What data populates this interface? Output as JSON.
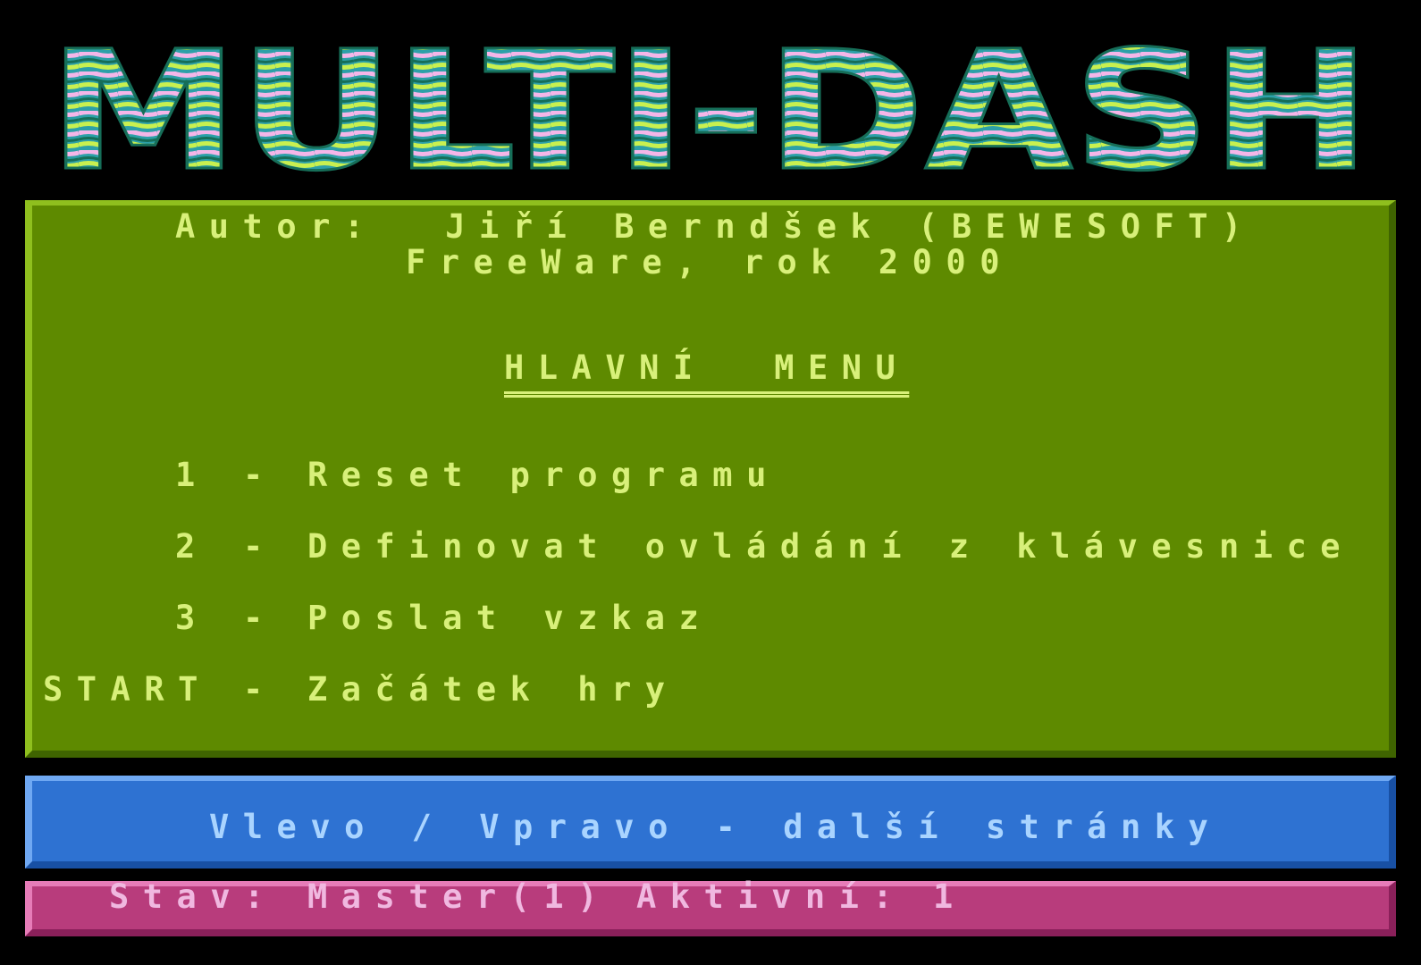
{
  "title": {
    "text": "MULTI-DASH",
    "colors": {
      "wave_pink": "#f4b6e8",
      "wave_teal": "#2ca0a8",
      "wave_lime": "#c8f050",
      "wave_dark": "#166e58"
    }
  },
  "info": {
    "author_line": "Autor:  Jiří Berndšek (BEWESOFT)",
    "license_line": "FreeWare, rok 2000"
  },
  "menu": {
    "heading": "HLAVNÍ  MENU",
    "items": [
      {
        "key": "1",
        "label": "Reset programu"
      },
      {
        "key": "2",
        "label": "Definovat ovládání z klávesnice"
      },
      {
        "key": "3",
        "label": "Poslat vzkaz"
      },
      {
        "key": "START",
        "label": "Začátek hry"
      }
    ],
    "separator": "-"
  },
  "hint": {
    "text": "Vlevo / Vpravo - další stránky"
  },
  "status": {
    "label": "Stav:",
    "mode": "Master(1)",
    "active_label": "Aktivní:",
    "active_value": "1"
  },
  "colors": {
    "background": "#000000",
    "main_panel": "#5e8a00",
    "hint_panel": "#2e72d2",
    "status_panel": "#b83c7c",
    "text_yellow": "#d8f07a",
    "text_pink": "#f0b8e0",
    "text_light_blue": "#a9d4ff"
  }
}
